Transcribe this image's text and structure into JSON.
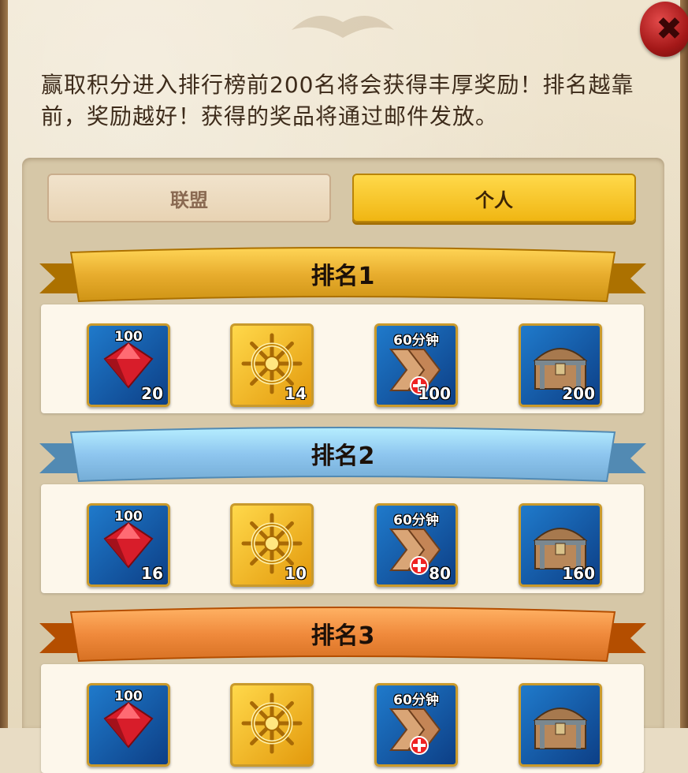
{
  "close": {
    "icon": "close-icon",
    "glyph": "✖"
  },
  "description": "赢取积分进入排行榜前200名将会获得丰厚奖励！排名越靠前，奖励越好！获得的奖品将通过邮件发放。",
  "tabs": [
    {
      "label": "联盟",
      "selected": false
    },
    {
      "label": "个人",
      "selected": true
    }
  ],
  "ranks": [
    {
      "title": "排名1",
      "color": "#e8ad2e",
      "rewards": [
        {
          "icon": "ruby-icon",
          "top": "100",
          "qty": "20"
        },
        {
          "icon": "ship-wheel-icon",
          "top": "",
          "qty": "14"
        },
        {
          "icon": "speedup-icon",
          "top": "60分钟",
          "qty": "100"
        },
        {
          "icon": "chest-icon",
          "top": "",
          "qty": "200"
        }
      ]
    },
    {
      "title": "排名2",
      "color": "#8ec6ef",
      "rewards": [
        {
          "icon": "ruby-icon",
          "top": "100",
          "qty": "16"
        },
        {
          "icon": "ship-wheel-icon",
          "top": "",
          "qty": "10"
        },
        {
          "icon": "speedup-icon",
          "top": "60分钟",
          "qty": "80"
        },
        {
          "icon": "chest-icon",
          "top": "",
          "qty": "160"
        }
      ]
    },
    {
      "title": "排名3",
      "color": "#f08a3c",
      "rewards": [
        {
          "icon": "ruby-icon",
          "top": "100",
          "qty": ""
        },
        {
          "icon": "ship-wheel-icon",
          "top": "",
          "qty": ""
        },
        {
          "icon": "speedup-icon",
          "top": "60分钟",
          "qty": ""
        },
        {
          "icon": "chest-icon",
          "top": "",
          "qty": ""
        }
      ]
    }
  ]
}
